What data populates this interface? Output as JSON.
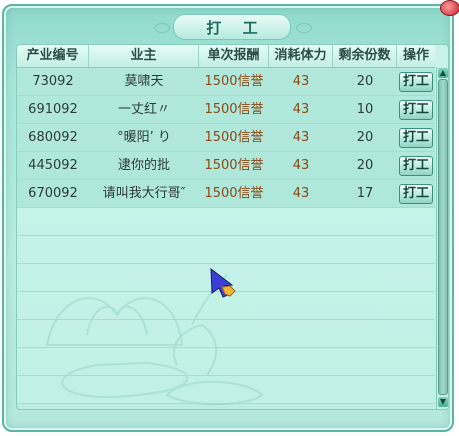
{
  "window": {
    "title": "打 工"
  },
  "table": {
    "headers": {
      "id": "产业编号",
      "owner": "业主",
      "reward": "单次报酬",
      "stamina": "消耗体力",
      "remaining": "剩余份数",
      "action": "操作"
    },
    "rows": [
      {
        "id": "73092",
        "owner": "莫啸天",
        "reward": "1500信誉",
        "stamina": "43",
        "remaining": "20",
        "action": "打工"
      },
      {
        "id": "691092",
        "owner": "一丈红〃",
        "reward": "1500信誉",
        "stamina": "43",
        "remaining": "10",
        "action": "打工"
      },
      {
        "id": "680092",
        "owner": "°暖阳’ り",
        "reward": "1500信誉",
        "stamina": "43",
        "remaining": "20",
        "action": "打工"
      },
      {
        "id": "445092",
        "owner": "逮你的批",
        "reward": "1500信誉",
        "stamina": "43",
        "remaining": "20",
        "action": "打工"
      },
      {
        "id": "670092",
        "owner": "请叫我大行哥″",
        "reward": "1500信誉",
        "stamina": "43",
        "remaining": "17",
        "action": "打工"
      }
    ]
  },
  "colors": {
    "panel": "#a9e6da",
    "accent_text": "#8a4a16",
    "button_border": "#3d8f7f"
  },
  "icons": {
    "close": "close-icon",
    "scroll_up": "scroll-up-arrow-icon",
    "scroll_down": "scroll-down-arrow-icon",
    "cursor": "arrow-cursor-icon"
  }
}
